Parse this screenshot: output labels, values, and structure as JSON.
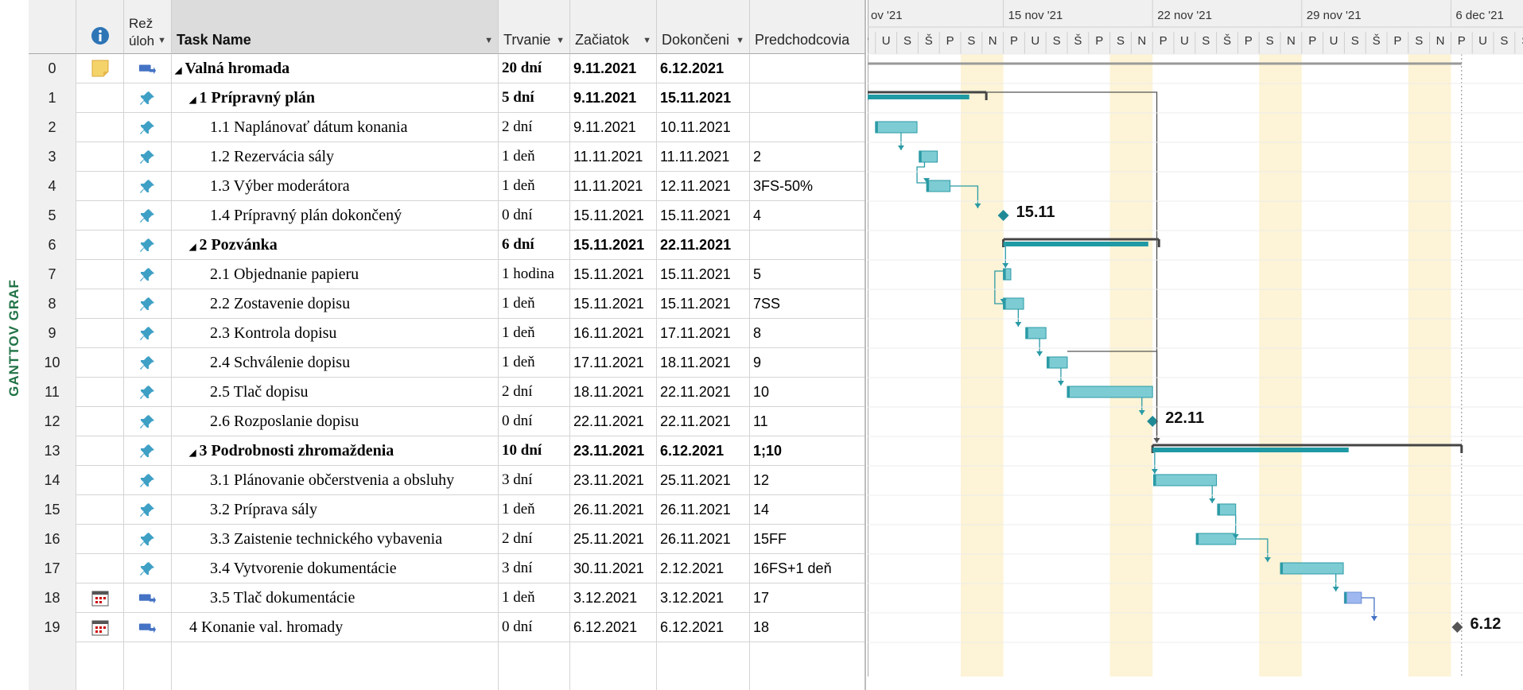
{
  "side_label": "GANTTOV GRAF",
  "columns": {
    "info_icon": "info-icon",
    "mode": "Rež\núloh",
    "name": "Task Name",
    "duration": "Trvanie",
    "start": "Začiatok",
    "finish": "Dokončeni",
    "pred": "Predchodcovia"
  },
  "timeline": {
    "weeks": [
      "ov '21",
      "15 nov '21",
      "22 nov '21",
      "29 nov '21",
      "6 dec '21"
    ],
    "day_letters": [
      "U",
      "S",
      "Š",
      "P",
      "S",
      "N",
      "P"
    ]
  },
  "tasks": [
    {
      "id": "0",
      "icon": "note-icon",
      "mode": "auto-scheduled-icon",
      "name": "Valná hromada",
      "dur": "20 dní",
      "start": "9.11.2021",
      "finish": "6.12.2021",
      "pred": "",
      "bold": true,
      "level": 0,
      "collapse": true
    },
    {
      "id": "1",
      "mode": "manual-pin-icon",
      "name": "1 Prípravný plán",
      "dur": "5 dní",
      "start": "9.11.2021",
      "finish": "15.11.2021",
      "pred": "",
      "bold": true,
      "level": 1,
      "collapse": true
    },
    {
      "id": "2",
      "mode": "manual-pin-icon",
      "name": "1.1 Naplánovať dátum konania",
      "dur": "2 dní",
      "start": "9.11.2021",
      "finish": "10.11.2021",
      "pred": "",
      "bold": false,
      "level": 2
    },
    {
      "id": "3",
      "mode": "manual-pin-icon",
      "name": "1.2 Rezervácia sály",
      "dur": "1 deň",
      "start": "11.11.2021",
      "finish": "11.11.2021",
      "pred": "2",
      "bold": false,
      "level": 2
    },
    {
      "id": "4",
      "mode": "manual-pin-icon",
      "name": "1.3 Výber moderátora",
      "dur": "1 deň",
      "start": "11.11.2021",
      "finish": "12.11.2021",
      "pred": "3FS-50%",
      "bold": false,
      "level": 2
    },
    {
      "id": "5",
      "mode": "manual-pin-icon",
      "name": "1.4 Prípravný plán dokončený",
      "dur": "0 dní",
      "start": "15.11.2021",
      "finish": "15.11.2021",
      "pred": "4",
      "bold": false,
      "level": 2
    },
    {
      "id": "6",
      "mode": "manual-pin-icon",
      "name": "2 Pozvánka",
      "dur": "6 dní",
      "start": "15.11.2021",
      "finish": "22.11.2021",
      "pred": "",
      "bold": true,
      "level": 1,
      "collapse": true
    },
    {
      "id": "7",
      "mode": "manual-pin-icon",
      "name": "2.1 Objednanie papieru",
      "dur": "1 hodina",
      "start": "15.11.2021",
      "finish": "15.11.2021",
      "pred": "5",
      "bold": false,
      "level": 2
    },
    {
      "id": "8",
      "mode": "manual-pin-icon",
      "name": "2.2 Zostavenie dopisu",
      "dur": "1 deň",
      "start": "15.11.2021",
      "finish": "15.11.2021",
      "pred": "7SS",
      "bold": false,
      "level": 2
    },
    {
      "id": "9",
      "mode": "manual-pin-icon",
      "name": "2.3 Kontrola dopisu",
      "dur": "1 deň",
      "start": "16.11.2021",
      "finish": "17.11.2021",
      "pred": "8",
      "bold": false,
      "level": 2
    },
    {
      "id": "10",
      "mode": "manual-pin-icon",
      "name": "2.4 Schválenie dopisu",
      "dur": "1 deň",
      "start": "17.11.2021",
      "finish": "18.11.2021",
      "pred": "9",
      "bold": false,
      "level": 2
    },
    {
      "id": "11",
      "mode": "manual-pin-icon",
      "name": "2.5 Tlač dopisu",
      "dur": "2 dní",
      "start": "18.11.2021",
      "finish": "22.11.2021",
      "pred": "10",
      "bold": false,
      "level": 2
    },
    {
      "id": "12",
      "mode": "manual-pin-icon",
      "name": "2.6 Rozposlanie dopisu",
      "dur": "0 dní",
      "start": "22.11.2021",
      "finish": "22.11.2021",
      "pred": "11",
      "bold": false,
      "level": 2
    },
    {
      "id": "13",
      "mode": "manual-pin-icon",
      "name": "3 Podrobnosti zhromaždenia",
      "dur": "10 dní",
      "start": "23.11.2021",
      "finish": "6.12.2021",
      "pred": "1;10",
      "bold": true,
      "level": 1,
      "collapse": true
    },
    {
      "id": "14",
      "mode": "manual-pin-icon",
      "name": "3.1 Plánovanie občerstvenia a obsluhy",
      "dur": "3 dní",
      "start": "23.11.2021",
      "finish": "25.11.2021",
      "pred": "12",
      "bold": false,
      "level": 2
    },
    {
      "id": "15",
      "mode": "manual-pin-icon",
      "name": "3.2 Príprava sály",
      "dur": "1 deň",
      "start": "26.11.2021",
      "finish": "26.11.2021",
      "pred": "14",
      "bold": false,
      "level": 2
    },
    {
      "id": "16",
      "mode": "manual-pin-icon",
      "name": "3.3 Zaistenie technického vybavenia",
      "dur": "2 dní",
      "start": "25.11.2021",
      "finish": "26.11.2021",
      "pred": "15FF",
      "bold": false,
      "level": 2
    },
    {
      "id": "17",
      "mode": "manual-pin-icon",
      "name": "3.4 Vytvorenie dokumentácie",
      "dur": "3 dní",
      "start": "30.11.2021",
      "finish": "2.12.2021",
      "pred": "16FS+1 deň",
      "bold": false,
      "level": 2
    },
    {
      "id": "18",
      "icon": "calendar-icon",
      "mode": "auto-scheduled-icon",
      "name": "3.5 Tlač dokumentácie",
      "dur": "1 deň",
      "start": "3.12.2021",
      "finish": "3.12.2021",
      "pred": "17",
      "bold": false,
      "level": 2
    },
    {
      "id": "19",
      "icon": "calendar-icon",
      "mode": "auto-scheduled-icon",
      "name": "4 Konanie val. hromady",
      "dur": "0 dní",
      "start": "6.12.2021",
      "finish": "6.12.2021",
      "pred": "18",
      "bold": false,
      "level": 1
    }
  ],
  "milestones": {
    "m5": "15.11",
    "m12": "22.11",
    "m19": "6.12"
  },
  "colors": {
    "bar": "#7dccd4",
    "bar_border": "#2a9aa5",
    "summary": "#1f9aa4",
    "weekend": "#fdf3d6",
    "link": "#2a9aa5",
    "manual_bar": "#9fb9f0"
  }
}
